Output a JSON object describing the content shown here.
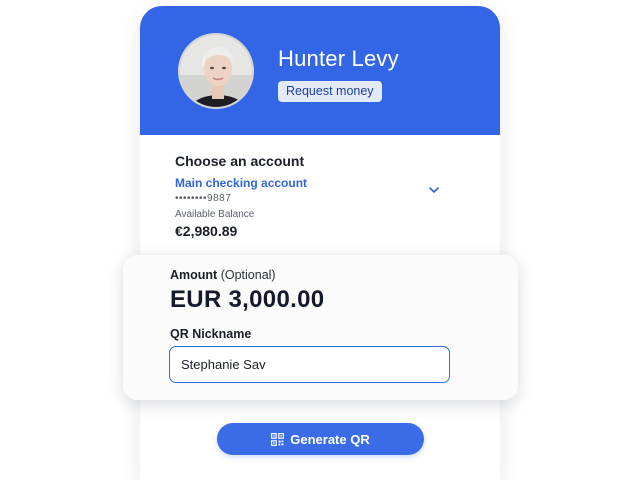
{
  "profile": {
    "name": "Hunter Levy",
    "request_label": "Request money",
    "avatar_icon": "user-avatar-photo"
  },
  "account": {
    "section_title": "Choose an account",
    "selected_name": "Main checking account",
    "masked_number": "••••••••9887",
    "available_label": "Available Balance",
    "balance": "€2,980.89",
    "dropdown_icon": "chevron-down-icon"
  },
  "amount": {
    "label": "Amount",
    "optional_note": "(Optional)",
    "value": "EUR 3,000.00"
  },
  "nickname": {
    "label": "QR Nickname",
    "value": "Stephanie Sav"
  },
  "actions": {
    "generate_label": "Generate QR",
    "generate_icon": "qr-code-icon"
  },
  "colors": {
    "header_blue": "#3366e6",
    "accent_blue": "#3a6ce8",
    "link_blue": "#2f66d8"
  }
}
